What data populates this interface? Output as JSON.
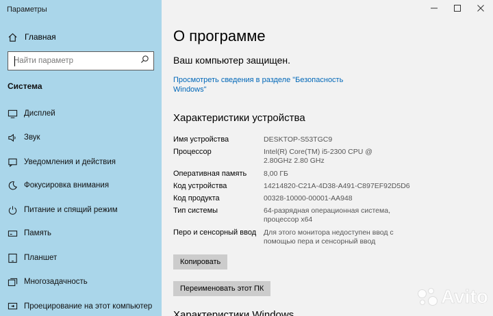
{
  "window": {
    "title": "Параметры",
    "controls": [
      "minimize-icon",
      "maximize-icon",
      "close-icon"
    ]
  },
  "sidebar": {
    "home_label": "Главная",
    "search_placeholder": "Найти параметр",
    "section_label": "Система",
    "items": [
      {
        "label": "Дисплей",
        "icon": "display-icon"
      },
      {
        "label": "Звук",
        "icon": "sound-icon"
      },
      {
        "label": "Уведомления и действия",
        "icon": "notifications-icon"
      },
      {
        "label": "Фокусировка внимания",
        "icon": "focus-assist-icon"
      },
      {
        "label": "Питание и спящий режим",
        "icon": "power-icon"
      },
      {
        "label": "Память",
        "icon": "storage-icon"
      },
      {
        "label": "Планшет",
        "icon": "tablet-icon"
      },
      {
        "label": "Многозадачность",
        "icon": "multitasking-icon"
      },
      {
        "label": "Проецирование на этот компьютер",
        "icon": "projecting-icon"
      }
    ]
  },
  "main": {
    "title": "О программе",
    "protected_text": "Ваш компьютер защищен.",
    "security_link": "Просмотреть сведения в разделе \"Безопасность Windows\"",
    "specs_title": "Характеристики устройства",
    "specs": [
      {
        "label": "Имя устройства",
        "value": "DESKTOP-S53TGC9"
      },
      {
        "label": "Процессор",
        "value": "Intel(R) Core(TM) i5-2300 CPU @ 2.80GHz 2.80 GHz"
      },
      {
        "label": "Оперативная память",
        "value": "8,00 ГБ"
      },
      {
        "label": "Код устройства",
        "value": "14214820-C21A-4D38-A491-C897EF92D5D6"
      },
      {
        "label": "Код продукта",
        "value": "00328-10000-00001-AA948"
      },
      {
        "label": "Тип системы",
        "value": "64-разрядная операционная система, процессор x64"
      },
      {
        "label": "Перо и сенсорный ввод",
        "value": "Для этого монитора недоступен ввод с помощью пера и сенсорный ввод"
      }
    ],
    "copy_button": "Копировать",
    "rename_button": "Переименовать этот ПК",
    "footer_partial": "Характеристики Windows"
  },
  "watermark": "Avito",
  "colors": {
    "sidebar_bg": "#aad6ea",
    "main_bg": "#f2f2f2",
    "link": "#0067b8",
    "button_bg": "#cccccc"
  }
}
